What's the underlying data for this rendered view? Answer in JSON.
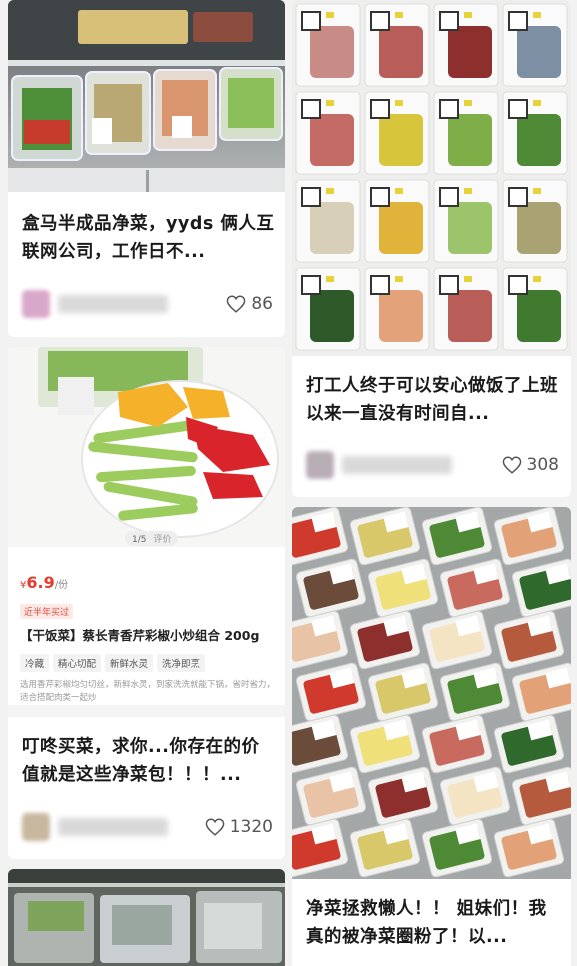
{
  "feed": {
    "left": [
      {
        "title": "盒马半成品净菜，yyds 俩人互联网公司，工作日不...",
        "likes": "86",
        "photo": "fridge-vegetable-trays"
      },
      {
        "title": "叮咚买菜，求你...你存在的价值就是这些净菜包！！！...",
        "likes": "1320",
        "photo": "vegetable-plate",
        "product": {
          "pager": "1/5",
          "pager_extra": "评价",
          "price_currency": "¥",
          "price": "6.9",
          "price_unit": "/份",
          "badge": "近半年买过",
          "name": "【干饭菜】蔡长青香芹彩椒小炒组合 200g",
          "tags": [
            "冷藏",
            "精心切配",
            "新鲜水灵",
            "洗净即烹"
          ],
          "desc": "选用香芹彩椒均匀切丝，新鲜水灵，到家洗洗就能下锅，省时省力，适合搭配肉类一起炒"
        }
      },
      {
        "title": "",
        "likes": "",
        "photo": "packaged-vegetables-shelf"
      }
    ],
    "right": [
      {
        "title": "打工人终于可以安心做饭了上班以来一直没有时间自...",
        "likes": "308",
        "photo": "vacuum-packs-grid"
      },
      {
        "title": "净菜拯救懒人！！ 姐妹们！我真的被净菜圈粉了！以...",
        "likes": "",
        "photo": "boxed-meal-kits"
      }
    ]
  },
  "colors": {
    "background": "#f2f2f2",
    "card": "#ffffff",
    "price_red": "#e83a2b",
    "text": "#1a1a1a"
  }
}
